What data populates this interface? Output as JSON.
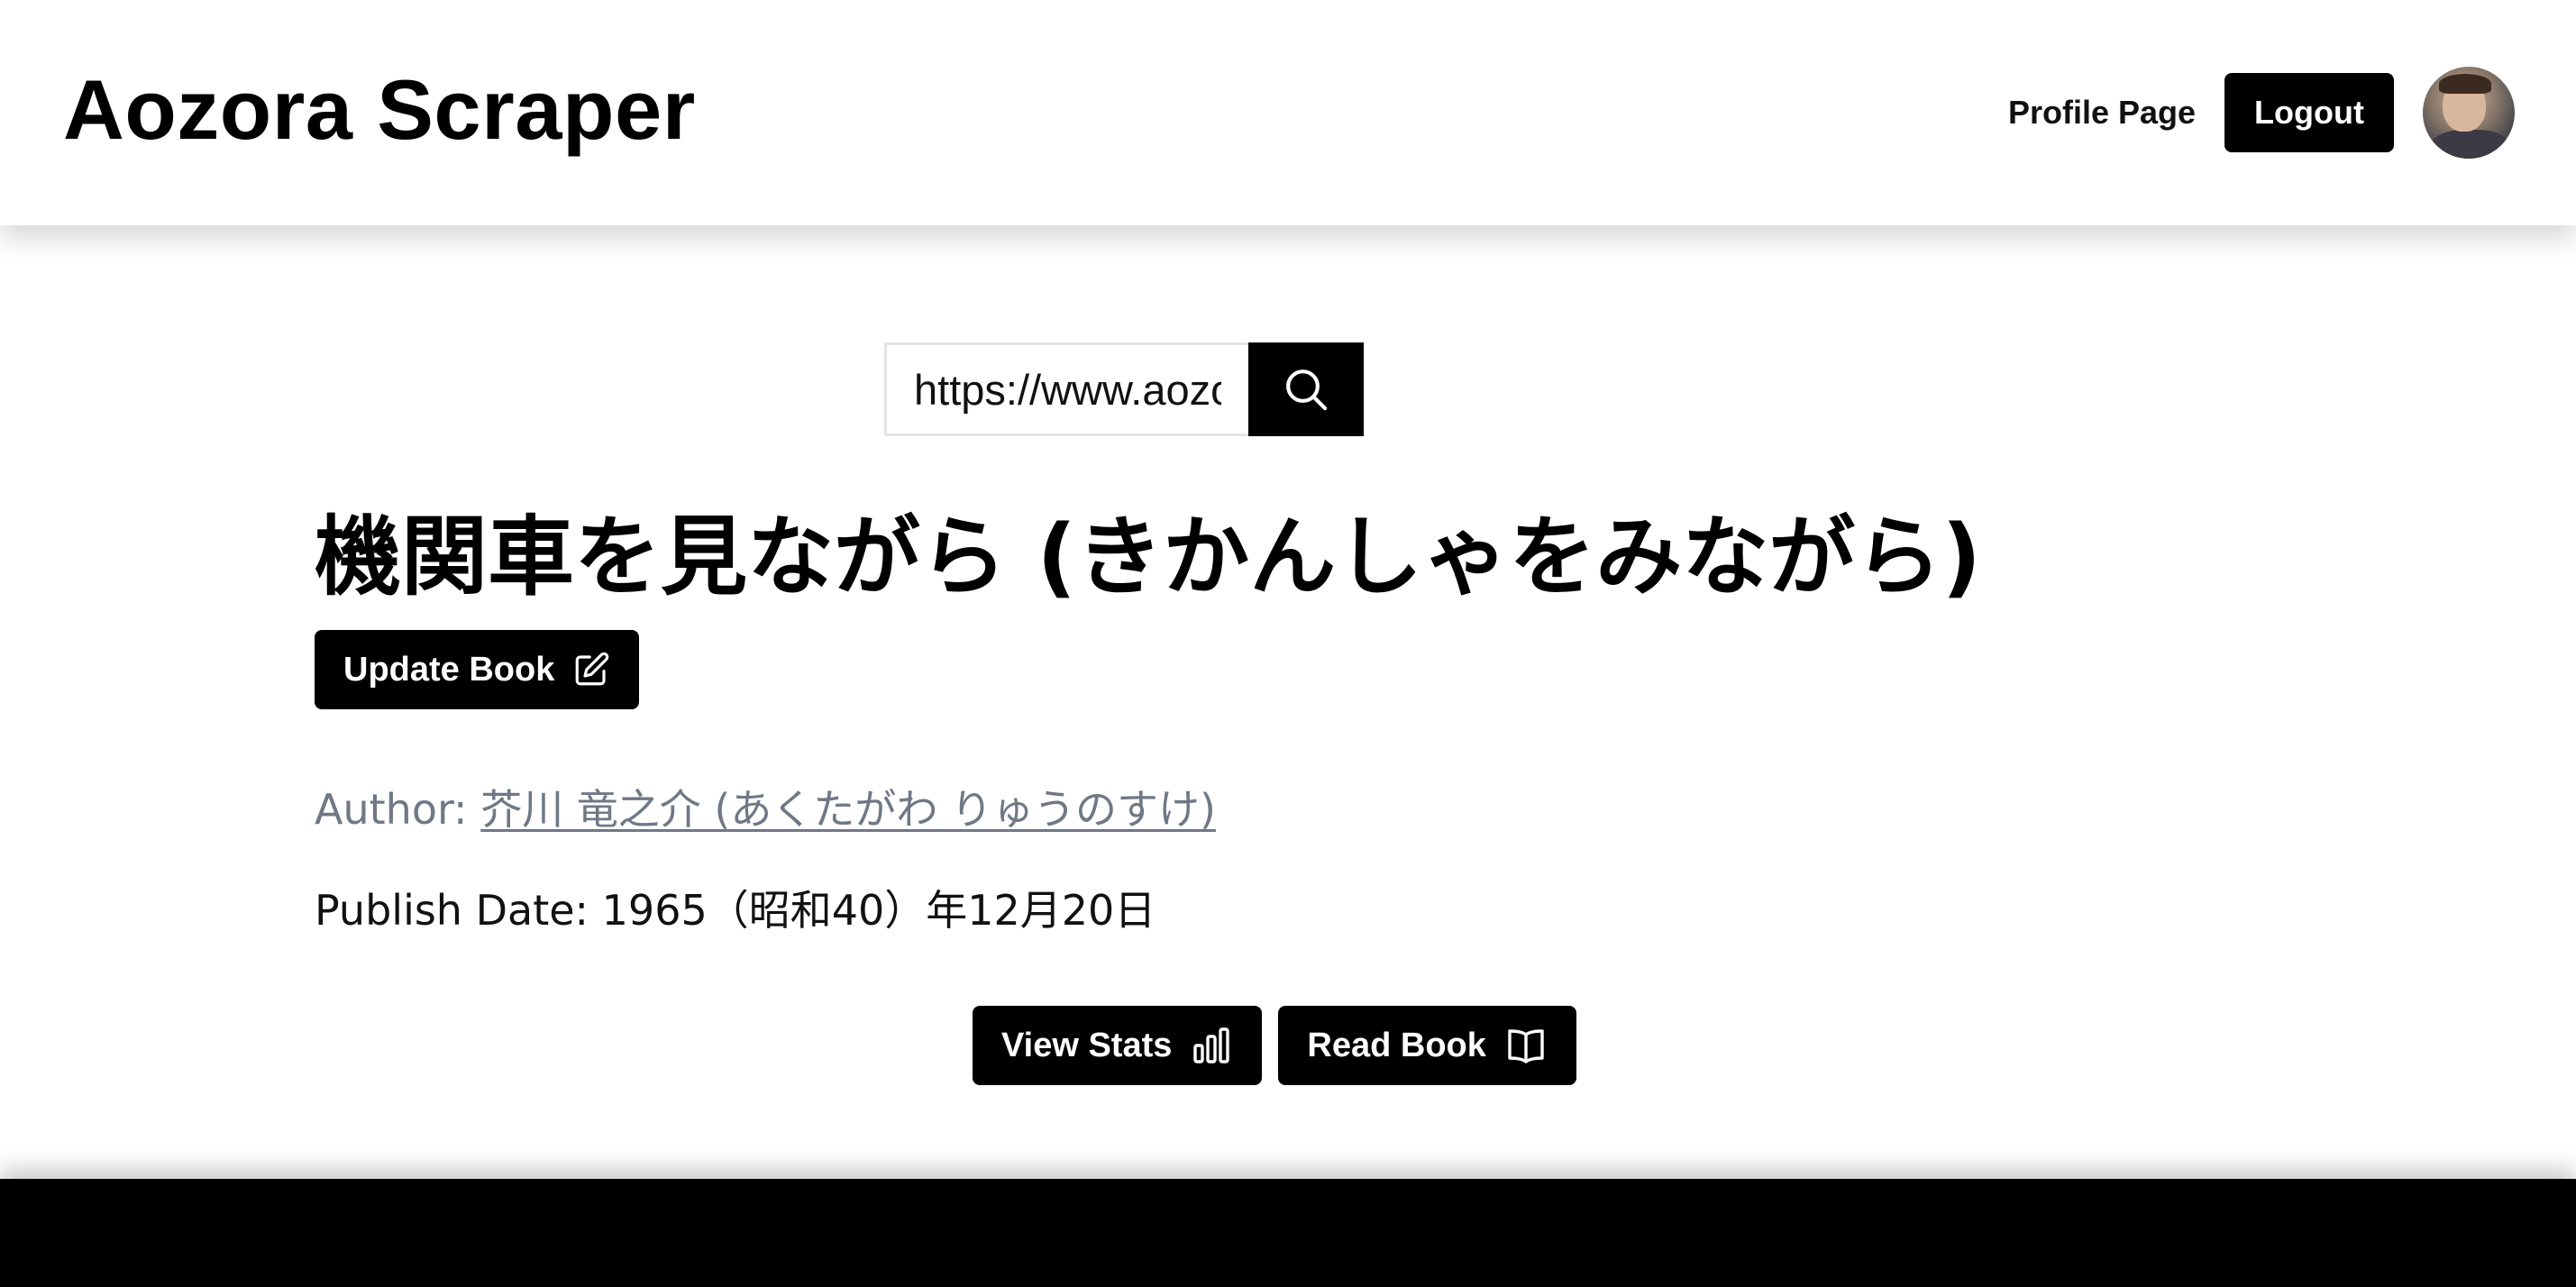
{
  "header": {
    "app_title": "Aozora Scraper",
    "profile_link": "Profile Page",
    "logout_label": "Logout"
  },
  "search": {
    "value": "https://www.aozora.gr.jp/cards",
    "icon": "search-icon"
  },
  "book": {
    "title": "機関車を見ながら (きかんしゃをみながら)",
    "update_label": "Update Book",
    "update_icon": "edit-icon",
    "author_prefix": "Author:",
    "author_name": "芥川 竜之介 (あくたがわ りゅうのすけ)",
    "publish_prefix": "Publish Date:",
    "publish_date": "1965（昭和40）年12月20日"
  },
  "actions": {
    "stats_label": "View Stats",
    "stats_icon": "bar-chart-icon",
    "read_label": "Read Book",
    "read_icon": "book-open-icon"
  },
  "colors": {
    "primary": "#000000",
    "muted_text": "#707886",
    "background": "#ffffff"
  }
}
